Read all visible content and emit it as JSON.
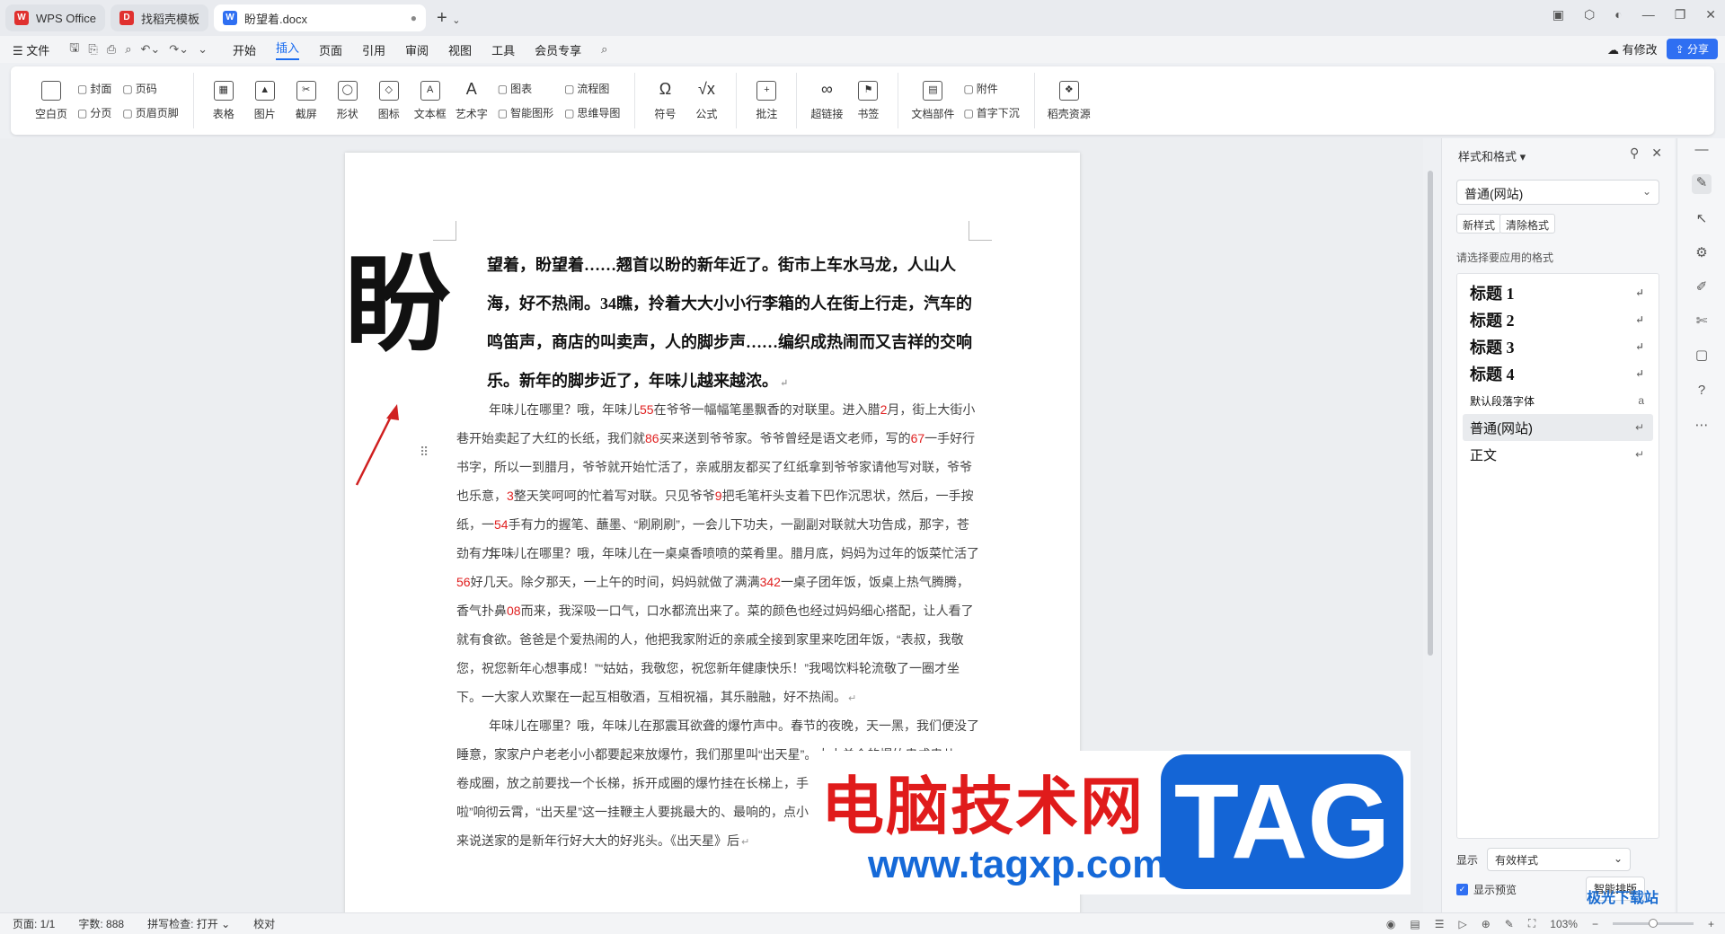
{
  "titlebar": {
    "tabs": [
      {
        "label": "WPS Office"
      },
      {
        "label": "找稻壳模板"
      },
      {
        "label": "盼望着.docx"
      }
    ]
  },
  "menubar": {
    "file": "文件",
    "items": [
      "开始",
      "插入",
      "页面",
      "引用",
      "审阅",
      "视图",
      "工具",
      "会员专享"
    ],
    "active": "插入",
    "modified": "有修改",
    "share": "分享"
  },
  "ribbon": {
    "blank_page": "空白页",
    "cover": "封面",
    "page_break": "分页",
    "page_num": "页码",
    "header_footer": "页眉页脚",
    "table": "表格",
    "picture": "图片",
    "screenshot": "截屏",
    "shape": "形状",
    "icon": "图标",
    "textbox": "文本框",
    "wordart": "艺术字",
    "chart": "图表",
    "smart_graphic": "智能图形",
    "flowchart": "流程图",
    "mindmap": "思维导图",
    "symbol": "符号",
    "formula": "公式",
    "comment": "批注",
    "hyperlink": "超链接",
    "bookmark": "书签",
    "doc_parts": "文档部件",
    "attachment": "附件",
    "drop_cap": "首字下沉",
    "daoke": "稻壳资源"
  },
  "document": {
    "dropcap_char": "盼",
    "first_para": "望着，盼望着……翘首以盼的新年近了。街市上车水马龙，人山人海，好不热闹。34瞧，拎着大大小小行李箱的人在街上行走，汽车的鸣笛声，商店的叫卖声，人的脚步声……编织成热闹而又吉祥的交响乐。新年的脚步近了，年味儿越来越浓。",
    "para2": [
      {
        "t": "年味儿在哪里？哦，年味儿"
      },
      {
        "n": "55"
      },
      {
        "t": "在爷爷一幅幅笔墨飘香的对联里。进入腊"
      },
      {
        "n": "2"
      },
      {
        "t": "月，街上大街小巷开始卖起了大红的长纸，我们就"
      },
      {
        "n": "86"
      },
      {
        "t": "买来送到爷爷家。爷爷曾经是语文老师，写的"
      },
      {
        "n": "67"
      },
      {
        "t": "一手好行书字，所以一到腊月，爷爷就开始忙活了，亲戚朋友都买了红纸拿到爷爷家请他写对联，爷爷也乐意，"
      },
      {
        "n": "3"
      },
      {
        "t": "整天笑呵呵的忙着写对联。只见爷爷"
      },
      {
        "n": "9"
      },
      {
        "t": "把毛笔杆头支着下巴作沉思状，然后，一手按纸，一"
      },
      {
        "n": "54"
      },
      {
        "t": "手有力的握笔、蘸墨、“刷刷刷”，一会儿下功夫，一副副对联就大功告成，那字，苍劲有力。"
      }
    ],
    "para3": [
      {
        "t": "年味儿在哪里？哦，年味儿在一桌桌香喷喷的菜肴里。腊月底，妈妈为过年的饭菜忙活了"
      },
      {
        "n": "56"
      },
      {
        "t": "好几天。除夕那天，一上午的时间，妈妈就做了满满"
      },
      {
        "n": "342"
      },
      {
        "t": "一桌子团年饭，饭桌上热气腾腾，香气扑鼻"
      },
      {
        "n": "08"
      },
      {
        "t": "而来，我深吸一口气，口水都流出来了。菜的颜色也经过妈妈细心搭配，让人看了就有食欲。爸爸是个爱热闹的人，他把我家附近的亲戚全接到家里来吃团年饭，“表叔，我敬您，祝您新年心想事成！”“姑姑，我敬您，祝您新年健康快乐！”我喝饮料轮流敬了一圈才坐下。一大家人欢聚在一起互相敬酒，互相祝福，其乐融融，好不热闹。"
      }
    ],
    "para4": [
      {
        "t": "年味儿在哪里？哦，年味儿在那震耳欲聋的爆竹声中。春节的夜晚，天一黑，我们便没了睡意，家家户户老老小小都要起来放爆竹，我们那里叫“出天星”。大小单个的爆竹串成串儿，卷成圈，放之前要找一个长梯，拆开成圈的爆竹挂在长梯上，手握长把点燃导火线，“噼里啪啦”响彻云霄，“出天星”这一挂鞭主人要挑最大的、最响的，点小把火要等的最响的，听爷爷起来说送家的是新年行好大大的好兆头。《出天星》后"
      }
    ],
    "para_mark": "↵"
  },
  "panel": {
    "title": "样式和格式",
    "current_style": "普通(网站)",
    "new_style": "新样式",
    "clear_format": "清除格式",
    "hint": "请选择要应用的格式",
    "styles": [
      {
        "label": "标题 1",
        "kind": "h"
      },
      {
        "label": "标题 2",
        "kind": "h"
      },
      {
        "label": "标题 3",
        "kind": "h"
      },
      {
        "label": "标题 4",
        "kind": "h"
      },
      {
        "label": "默认段落字体",
        "kind": "sm"
      },
      {
        "label": "普通(网站)",
        "kind": "norm",
        "selected": true
      },
      {
        "label": "正文",
        "kind": "norm"
      }
    ],
    "show_label": "显示",
    "show_value": "有效样式",
    "preview": "显示预览",
    "smart": "智能排版"
  },
  "statusbar": {
    "page": "页面: 1/1",
    "words": "字数: 888",
    "spell": "拼写检查: 打开",
    "proof": "校对",
    "zoom": "103%"
  },
  "watermark": {
    "cn": "电脑技术网",
    "tag": "TAG",
    "url": "www.tagxp.com",
    "corner": "极光下载站"
  },
  "colors": {
    "accent": "#1a6cf0",
    "number_red": "#e02020",
    "wm_red": "#e01b1b",
    "wm_blue": "#1465d6"
  }
}
